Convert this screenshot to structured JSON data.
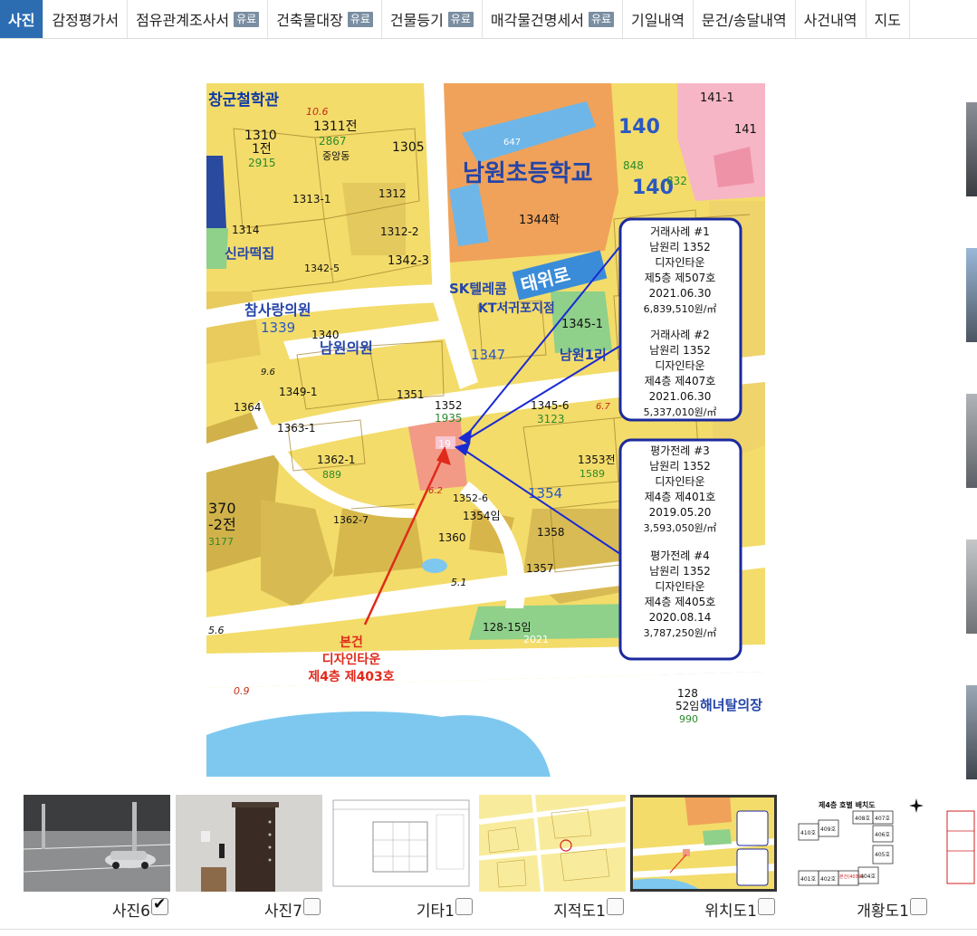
{
  "tabs": [
    {
      "label": "사진",
      "badge": "",
      "active": true
    },
    {
      "label": "감정평가서",
      "badge": ""
    },
    {
      "label": "점유관계조사서",
      "badge": "유료"
    },
    {
      "label": "건축물대장",
      "badge": "유료"
    },
    {
      "label": "건물등기",
      "badge": "유료"
    },
    {
      "label": "매각물건명세서",
      "badge": "유료"
    },
    {
      "label": "기일내역",
      "badge": ""
    },
    {
      "label": "문건/송달내역",
      "badge": ""
    },
    {
      "label": "사건내역",
      "badge": ""
    },
    {
      "label": "지도",
      "badge": ""
    }
  ],
  "map": {
    "school_name": "남원초등학교",
    "road_name": "태위로",
    "subject_label": [
      "본건",
      "디자인타운",
      "제4층 제403호"
    ],
    "cases": [
      {
        "title": "거래사례 #1",
        "addr": "남원리 1352",
        "bldg": "디자인타운",
        "unit": "제5층 제507호",
        "date": "2021.06.30",
        "price": "6,839,510원/㎡"
      },
      {
        "title": "거래사례 #2",
        "addr": "남원리 1352",
        "bldg": "디자인타운",
        "unit": "제4층 제407호",
        "date": "2021.06.30",
        "price": "5,337,010원/㎡"
      },
      {
        "title": "평가전례 #3",
        "addr": "남원리 1352",
        "bldg": "디자인타운",
        "unit": "제4층 제401호",
        "date": "2019.05.20",
        "price": "3,593,050원/㎡"
      },
      {
        "title": "평가전례 #4",
        "addr": "남원리 1352",
        "bldg": "디자인타운",
        "unit": "제4층 제405호",
        "date": "2020.08.14",
        "price": "3,787,250원/㎡"
      }
    ],
    "labels": {
      "l1": "창군철학관",
      "l2": "10.6",
      "l3": "1310",
      "l4": "1전",
      "l5": "2915",
      "l6": "1311전",
      "l7": "2867",
      "l8": "중앙동",
      "l9": "1305",
      "l10": "647",
      "l11": "1344학",
      "l12": "140",
      "l13": "141-1",
      "l14": "141",
      "l15": "848",
      "l16": "832",
      "l17": "신라떡집",
      "l18": "1342-5",
      "l19": "1342-3",
      "l20": "SK텔레콤",
      "l21": "KT서귀포지점",
      "l22": "1345-1",
      "l23": "남원1리",
      "l24": "참사랑의원",
      "l25": "1339",
      "l26": "남원의원",
      "l27": "1349-1",
      "l28": "1364",
      "l29": "1351",
      "l30": "1352",
      "l31": "1935",
      "l32": "19",
      "l33": "1363-1",
      "l34": "1362-1",
      "l35": "889",
      "l36": "1353전",
      "l37": "1354",
      "l38": "1589",
      "l39": "370",
      "l40": "-2전",
      "l41": "3177",
      "l42": "1354임",
      "l43": "1360",
      "l44": "1358",
      "l45": "1357",
      "l46": "128-15임",
      "l47": "2021",
      "l48": "5.1",
      "l49": "5.6",
      "l50": "0.9",
      "l51": "128",
      "l52": "52임",
      "l53": "990",
      "l54": "해녀탈의장",
      "l55": "6.7",
      "l56": "9.6",
      "l57": "3123",
      "l58": "1345-6",
      "l59": "1347",
      "l60": "1313-1",
      "l61": "1314",
      "l62": "1312",
      "l63": "1312-2",
      "l64": "1340",
      "l65": "1352-6",
      "l66": "1362-7",
      "l67": "6.2"
    }
  },
  "thumbnails": [
    {
      "caption": "사진6",
      "checked": true
    },
    {
      "caption": "사진7",
      "checked": false
    },
    {
      "caption": "기타1",
      "checked": false
    },
    {
      "caption": "지적도1",
      "checked": false
    },
    {
      "caption": "위치도1",
      "checked": false,
      "selected": true
    },
    {
      "caption": "개황도1",
      "checked": false
    },
    {
      "caption": "",
      "checked": false
    }
  ],
  "thumb_text": {
    "floorplan_title": "제4층 호별 배치도",
    "units": [
      "410호",
      "409호",
      "408호",
      "407호",
      "406호",
      "405호",
      "401호",
      "402호",
      "403호",
      "404호"
    ],
    "unit_target": "본건(403호)"
  },
  "colors": {
    "tab_active": "#2c6db2",
    "badge": "#7a8ea2",
    "map_yellow": "#f5de6e",
    "map_orange": "#f0a25a",
    "map_green": "#8fd08a",
    "map_water": "#7ec8ef",
    "map_road": "#ffffff",
    "callout_border": "#1b2a9e",
    "arrow_red": "#e02a1c",
    "arrow_blue": "#1b2ad2"
  }
}
